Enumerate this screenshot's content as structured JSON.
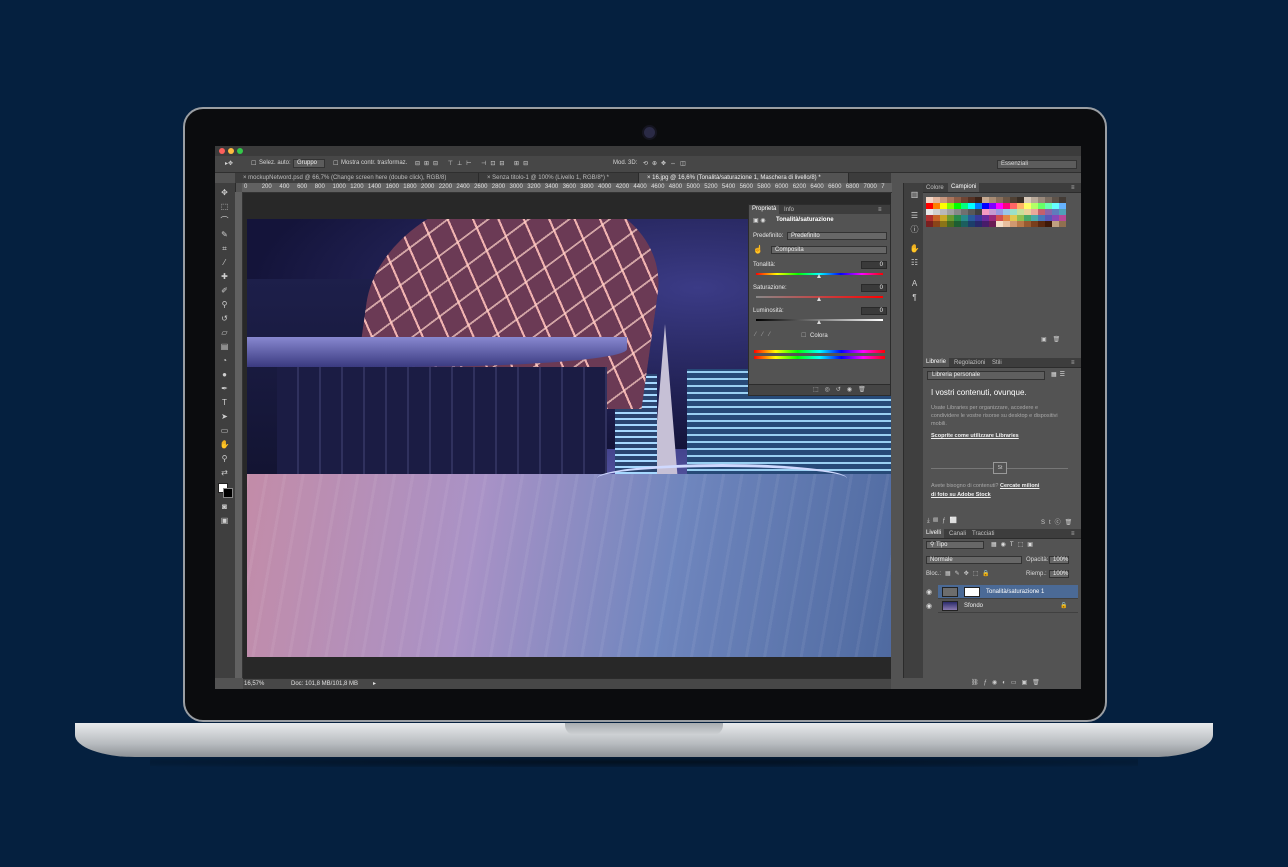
{
  "window": {
    "traffic_colors": [
      "#fc605c",
      "#fdbc40",
      "#34c84a"
    ]
  },
  "options_bar": {
    "auto_select_label": "Selez. auto:",
    "auto_select_value": "Gruppo",
    "transform_label": "Mostra contr. trasformaz.",
    "mode_3d_label": "Mod. 3D:",
    "workspace": "Essenziali"
  },
  "tabs": [
    {
      "label": "mockupNetword.psd @ 66,7% (Change screen here (doube click), RGB/8)"
    },
    {
      "label": "Senza titolo-1 @ 100% (Livello 1, RGB/8*) *"
    },
    {
      "label": "16.jpg @ 16,6% (Tonalità/saturazione 1, Maschera di livello/8) *"
    }
  ],
  "ruler_ticks": [
    "0",
    "200",
    "400",
    "600",
    "800",
    "1000",
    "1200",
    "1400",
    "1600",
    "1800",
    "2000",
    "2200",
    "2400",
    "2600",
    "2800",
    "3000",
    "3200",
    "3400",
    "3600",
    "3800",
    "4000",
    "4200",
    "4400",
    "4600",
    "4800",
    "5000",
    "5200",
    "5400",
    "5600",
    "5800",
    "6000",
    "6200",
    "6400",
    "6600",
    "6800",
    "7000",
    "7"
  ],
  "status_bar": {
    "zoom": "16,57%",
    "doc": "Doc: 101,8 MB/101,8 MB"
  },
  "properties": {
    "tab_active": "Proprietà",
    "tab_other": "Info",
    "adjustment": "Tonalità/saturazione",
    "preset_label": "Predefinito:",
    "preset_value": "Predefinito",
    "channel_value": "Composita",
    "hue_label": "Tonalità:",
    "hue_value": "0",
    "sat_label": "Saturazione:",
    "sat_value": "0",
    "light_label": "Luminosità:",
    "light_value": "0",
    "colorize_label": "Colora"
  },
  "swatches_panel": {
    "tab_colore": "Colore",
    "tab_campioni": "Campioni",
    "colors": [
      "#f3d6c6",
      "#e2b49c",
      "#c8977e",
      "#a9755d",
      "#8b5b45",
      "#6e4433",
      "#553224",
      "#3c2318",
      "#c7a98f",
      "#a78b73",
      "#886f5b",
      "#6b5645",
      "#4f4033",
      "#392e25",
      "#d9c9b9",
      "#b9a999",
      "#99897b",
      "#7b6d61",
      "#5d5249",
      "#433b35",
      "#ff0000",
      "#ff7f00",
      "#ffff00",
      "#7fff00",
      "#00ff00",
      "#00ff7f",
      "#00ffff",
      "#007fff",
      "#0000ff",
      "#7f00ff",
      "#ff00ff",
      "#ff007f",
      "#ff6666",
      "#ffb366",
      "#ffff66",
      "#b3ff66",
      "#66ff66",
      "#66ffb3",
      "#66ffff",
      "#66b3ff",
      "#e8e8e8",
      "#d0d0d0",
      "#b8b8b8",
      "#a0a0a0",
      "#888888",
      "#707070",
      "#585858",
      "#404040",
      "#f49ac1",
      "#c79ad1",
      "#9a9ae0",
      "#9ac7e8",
      "#9ae0c7",
      "#c7e09a",
      "#e8d09a",
      "#e8a89a",
      "#c4606c",
      "#8c64a8",
      "#5f7cbc",
      "#4fa0b8",
      "#b03030",
      "#c86428",
      "#c8a828",
      "#6a9a30",
      "#2a8a4a",
      "#2a8a8a",
      "#2a5a9a",
      "#3a3a9a",
      "#6a2a9a",
      "#9a2a7a",
      "#d25050",
      "#e08848",
      "#e0c850",
      "#90c050",
      "#48a868",
      "#48a8a8",
      "#4878b8",
      "#5858b8",
      "#8848b8",
      "#b84898",
      "#7a2020",
      "#8a4418",
      "#8a7418",
      "#466a20",
      "#1c5e32",
      "#1c5e5e",
      "#1c3e6a",
      "#28286a",
      "#481c6a",
      "#6a1c54",
      "#f6e0c8",
      "#e8c0a0",
      "#d09870",
      "#b87848",
      "#985a30",
      "#783e1c",
      "#5a2810",
      "#3e1808",
      "#c0a080",
      "#907050"
    ]
  },
  "libraries": {
    "tab_librerie": "Librerie",
    "tab_regolazioni": "Regolazioni",
    "tab_stili": "Stili",
    "library_select": "Libreria personale",
    "title": "I vostri contenuti, ovunque.",
    "description": "Usate Libraries per organizzare, accedere e condividere le vostre risorse su desktop e dispositivi mobili.",
    "link": "Scoprite come utilizzare Libraries",
    "icon_label": "St",
    "stock_text": "Avete bisogno di contenuti?",
    "stock_link_1": "Cercate milioni",
    "stock_link_2": "di foto su Adobe Stock"
  },
  "layers": {
    "tab_livelli": "Livelli",
    "tab_canali": "Canali",
    "tab_tracciati": "Tracciati",
    "filter_value": "Tipo",
    "blend_mode": "Normale",
    "opacity_label": "Opacità:",
    "opacity_value": "100%",
    "lock_label": "Bloc.:",
    "fill_label": "Riemp.:",
    "fill_value": "100%",
    "items": [
      {
        "name": "Tonalità/saturazione 1",
        "selected": true
      },
      {
        "name": "Sfondo",
        "selected": false
      }
    ]
  }
}
